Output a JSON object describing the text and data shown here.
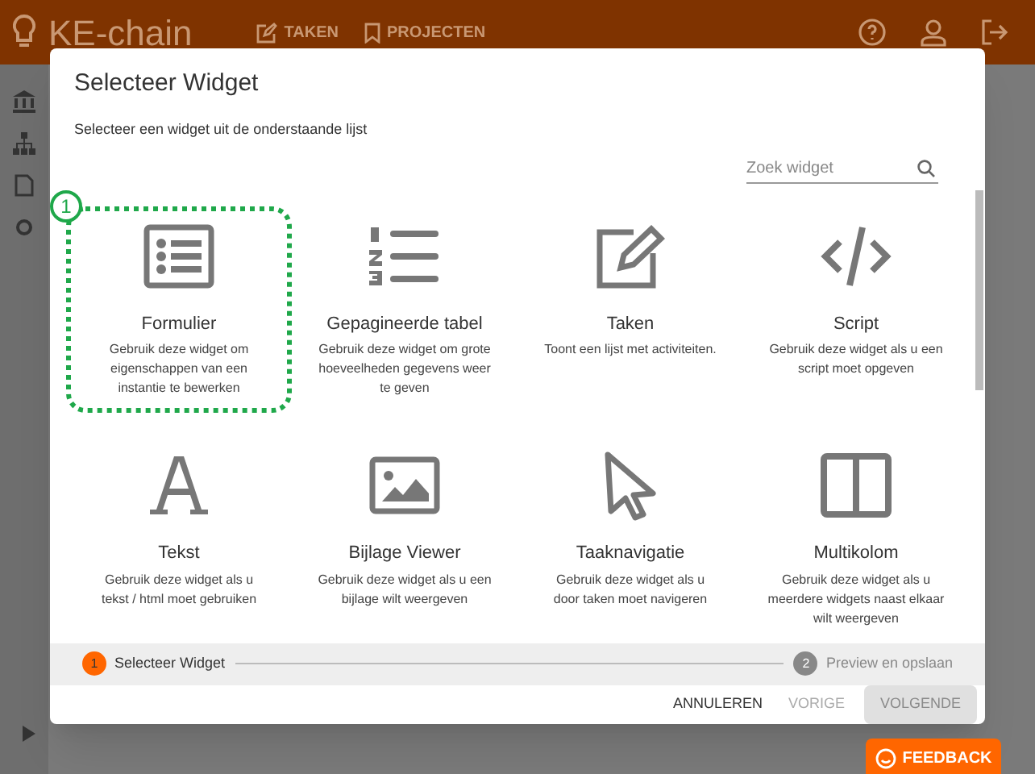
{
  "app": {
    "logo": "KE-chain",
    "nav": [
      "TAKEN",
      "PROJECTEN"
    ],
    "feedback": "FEEDBACK"
  },
  "dialog": {
    "title": "Selecteer Widget",
    "subtitle": "Selecteer een widget uit de onderstaande lijst",
    "search": {
      "placeholder": "Zoek widget"
    },
    "callout_label": "1",
    "widgets": [
      {
        "title": "Formulier",
        "description": "Gebruik deze widget om eigenschappen van een instantie te bewerken",
        "highlighted": true
      },
      {
        "title": "Gepagineerde tabel",
        "description": "Gebruik deze widget om grote hoeveelheden gegevens weer te geven",
        "highlighted": false
      },
      {
        "title": "Taken",
        "description": "Toont een lijst met activiteiten.",
        "highlighted": false
      },
      {
        "title": "Script",
        "description": "Gebruik deze widget als u een script moet opgeven",
        "highlighted": false
      },
      {
        "title": "Tekst",
        "description": "Gebruik deze widget als u tekst / html moet gebruiken",
        "highlighted": false
      },
      {
        "title": "Bijlage Viewer",
        "description": "Gebruik deze widget als u een bijlage wilt weergeven",
        "highlighted": false
      },
      {
        "title": "Taaknavigatie",
        "description": "Gebruik deze widget als u door taken moet navigeren",
        "highlighted": false
      },
      {
        "title": "Multikolom",
        "description": "Gebruik deze widget als u meerdere widgets naast elkaar wilt weergeven",
        "highlighted": false
      }
    ],
    "steps": [
      {
        "number": "1",
        "label": "Selecteer Widget",
        "active": true
      },
      {
        "number": "2",
        "label": "Preview en opslaan",
        "active": false
      }
    ],
    "buttons": [
      {
        "label": "ANNULEREN",
        "kind": "flat",
        "disabled": false
      },
      {
        "label": "VORIGE",
        "kind": "flat",
        "disabled": true
      },
      {
        "label": "VOLGENDE",
        "kind": "raised",
        "disabled": true
      }
    ]
  }
}
